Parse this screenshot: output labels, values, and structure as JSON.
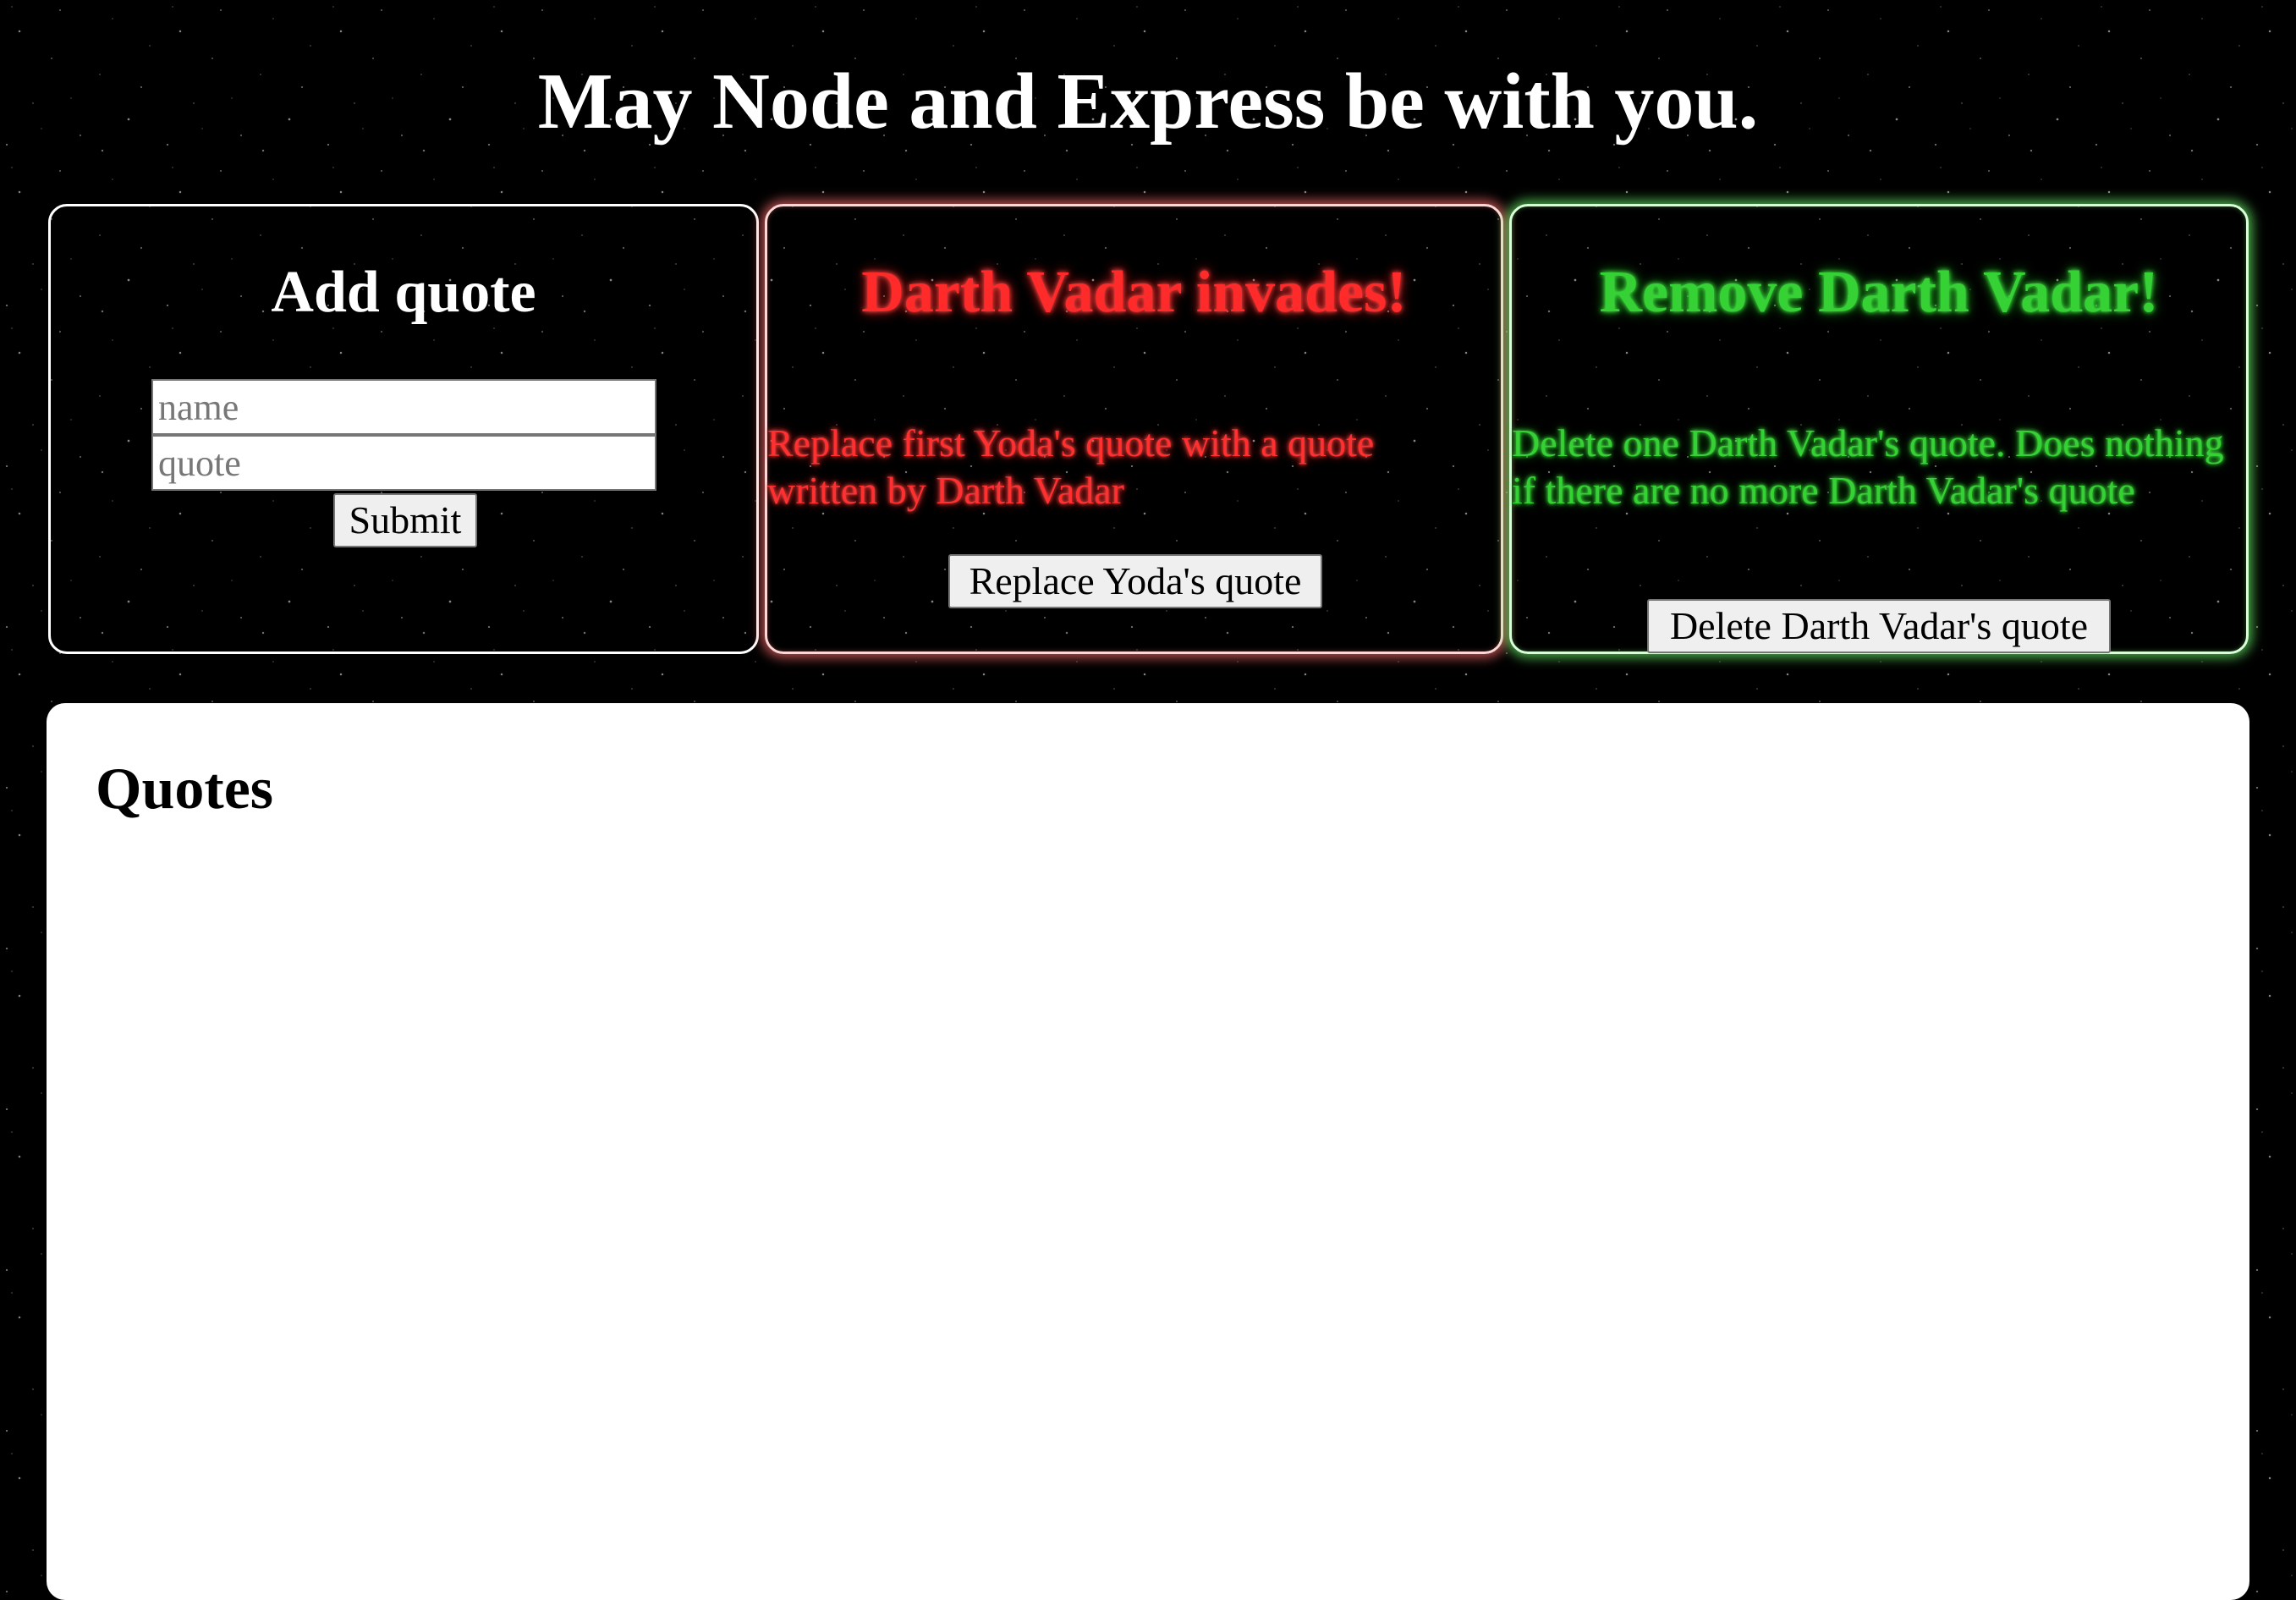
{
  "page": {
    "title": "May Node and Express be with you."
  },
  "add_panel": {
    "heading": "Add quote",
    "name_placeholder": "name",
    "quote_placeholder": "quote",
    "submit_label": "Submit"
  },
  "invade_panel": {
    "heading": "Darth Vadar invades!",
    "description": "Replace first Yoda's quote with a quote written by Darth Vadar",
    "button_label": "Replace Yoda's quote",
    "accent_color": "#ff2a2a"
  },
  "remove_panel": {
    "heading": "Remove Darth Vadar!",
    "description": "Delete one Darth Vadar's quote. Does nothing if there are no more Darth Vadar's quote",
    "button_label": "Delete Darth Vadar's quote",
    "accent_color": "#35d135"
  },
  "quotes_section": {
    "heading": "Quotes",
    "items": []
  }
}
